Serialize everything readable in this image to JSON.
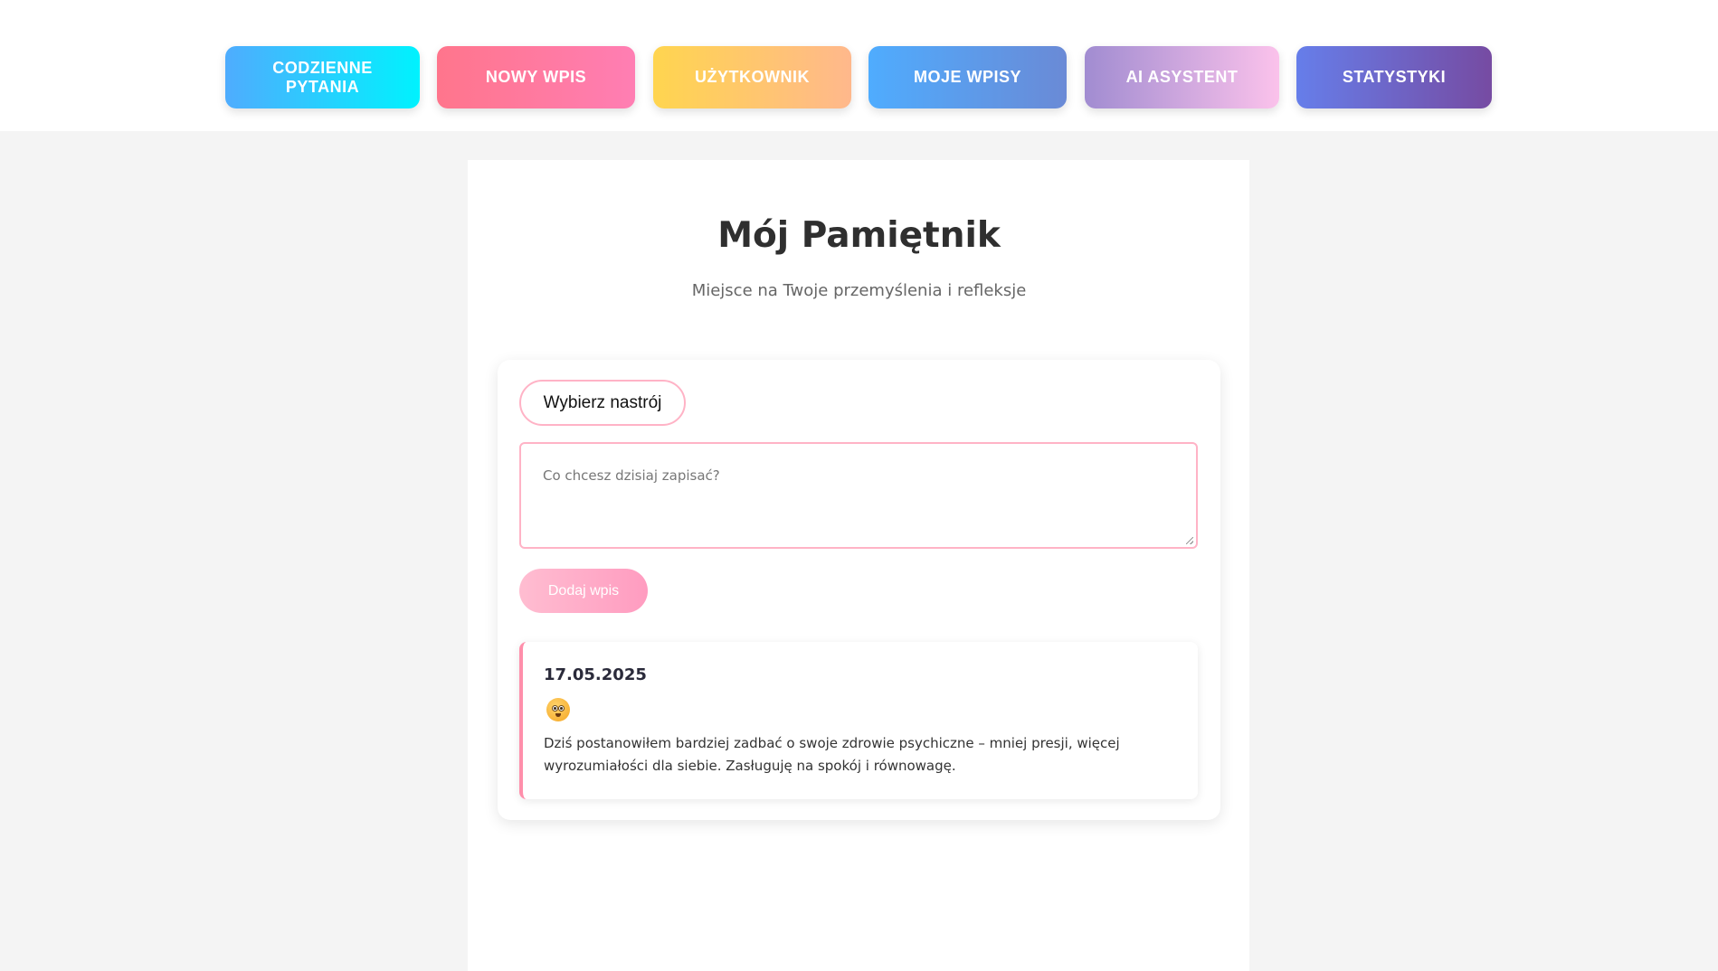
{
  "nav": {
    "items": [
      {
        "label": "CODZIENNE PYTANIA"
      },
      {
        "label": "NOWY WPIS"
      },
      {
        "label": "UŻYTKOWNIK"
      },
      {
        "label": "MOJE WPISY"
      },
      {
        "label": "AI ASYSTENT"
      },
      {
        "label": "STATYSTYKI"
      }
    ]
  },
  "page": {
    "title": "Mój Pamiętnik",
    "subtitle": "Miejsce na Twoje przemyślenia i refleksje"
  },
  "form": {
    "mood_select_label": "Wybierz nastrój",
    "textarea_placeholder": "Co chcesz dzisiaj zapisać?",
    "add_button_label": "Dodaj wpis"
  },
  "entries": [
    {
      "date": "17.05.2025",
      "mood_icon": "flushed-face-emoji",
      "text": "Dziś postanowiłem bardziej zadbać o swoje zdrowie psychiczne – mniej presji, więcej wyrozumiałości dla siebie. Zasługuję na spokój i równowagę."
    }
  ],
  "colors": {
    "accent_pink": "#ff8fab",
    "background": "#f4f4f4"
  }
}
